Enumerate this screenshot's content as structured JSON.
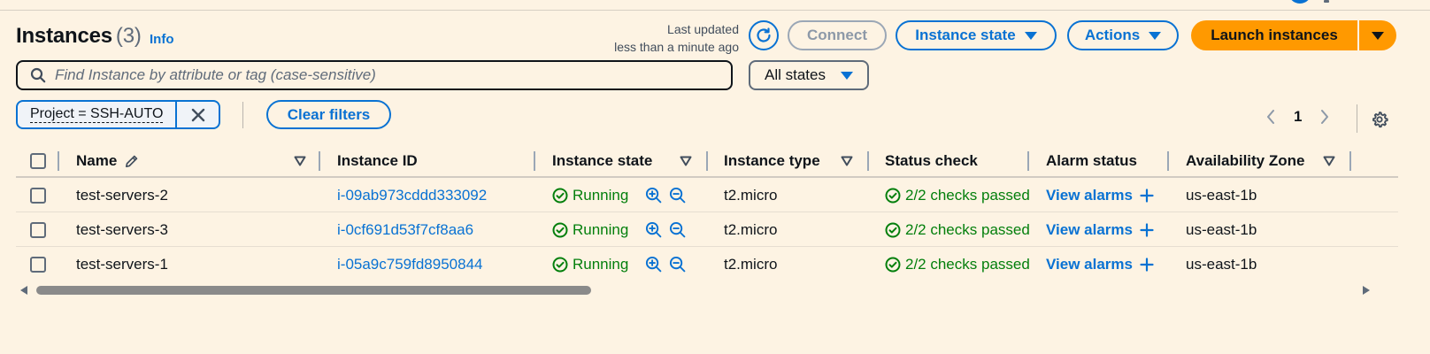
{
  "header": {
    "title": "Instances",
    "count": "(3)",
    "info_link": "Info",
    "last_updated_line1": "Last updated",
    "last_updated_line2": "less than a minute ago"
  },
  "toolbar": {
    "connect_label": "Connect",
    "instance_state_label": "Instance state",
    "actions_label": "Actions",
    "launch_label": "Launch instances"
  },
  "search": {
    "placeholder": "Find Instance by attribute or tag (case-sensitive)",
    "value": ""
  },
  "state_filter": {
    "selected": "All states"
  },
  "filters": {
    "tokens": [
      "Project = SSH-AUTO"
    ],
    "clear_label": "Clear filters"
  },
  "pagination": {
    "current_page": "1"
  },
  "table": {
    "columns": [
      "Name",
      "Instance ID",
      "Instance state",
      "Instance type",
      "Status check",
      "Alarm status",
      "Availability Zone"
    ],
    "rows": [
      {
        "name": "test-servers-2",
        "instance_id": "i-09ab973cddd333092",
        "state": "Running",
        "type": "t2.micro",
        "status_check": "2/2 checks passed",
        "alarm": "View alarms",
        "az": "us-east-1b"
      },
      {
        "name": "test-servers-3",
        "instance_id": "i-0cf691d53f7cf8aa6",
        "state": "Running",
        "type": "t2.micro",
        "status_check": "2/2 checks passed",
        "alarm": "View alarms",
        "az": "us-east-1b"
      },
      {
        "name": "test-servers-1",
        "instance_id": "i-05a9c759fd8950844",
        "state": "Running",
        "type": "t2.micro",
        "status_check": "2/2 checks passed",
        "alarm": "View alarms",
        "az": "us-east-1b"
      }
    ]
  },
  "colors": {
    "background": "#fdf3e3",
    "accent": "#0972d3",
    "primary_button": "#ff9900",
    "success": "#037f0c",
    "disabled": "#8d99a8"
  },
  "icons": {
    "refresh": "refresh-icon",
    "search": "search-icon",
    "close": "close-icon",
    "settings": "gear-icon",
    "edit": "pencil-icon",
    "status_ok": "check-circle-icon",
    "zoom_in": "zoom-in-icon",
    "zoom_out": "zoom-out-icon",
    "add": "plus-icon"
  }
}
